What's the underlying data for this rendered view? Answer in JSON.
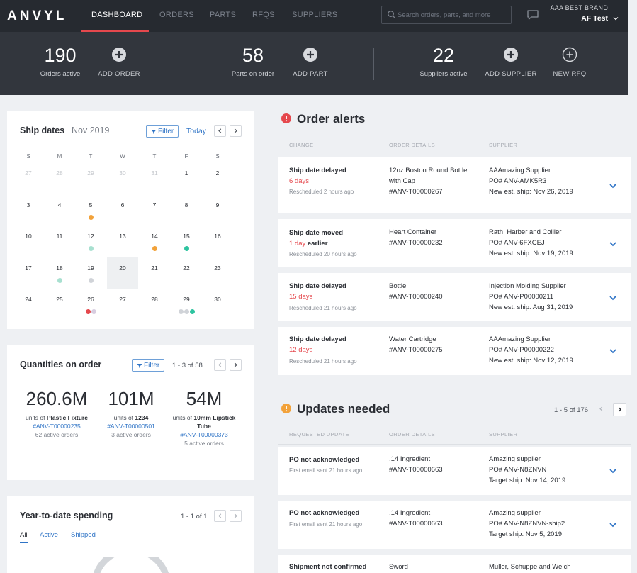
{
  "nav": {
    "logo": "ANVYL",
    "tabs": [
      "DASHBOARD",
      "ORDERS",
      "PARTS",
      "RFQS",
      "SUPPLIERS"
    ],
    "search_placeholder": "Search orders, parts, and more",
    "brand": "AAA BEST BRAND",
    "user": "AF Test"
  },
  "stats": {
    "orders_active": {
      "value": "190",
      "label": "Orders active",
      "action": "ADD ORDER"
    },
    "parts_on_order": {
      "value": "58",
      "label": "Parts on order",
      "action": "ADD PART"
    },
    "suppliers_active": {
      "value": "22",
      "label": "Suppliers active",
      "action": "ADD SUPPLIER"
    },
    "new_rfq": "NEW RFQ"
  },
  "ship_dates": {
    "title": "Ship dates",
    "month": "Nov 2019",
    "filter": "Filter",
    "today": "Today",
    "dow": [
      "S",
      "M",
      "T",
      "W",
      "T",
      "F",
      "S"
    ],
    "weeks": [
      [
        {
          "d": "27",
          "m": true
        },
        {
          "d": "28",
          "m": true
        },
        {
          "d": "29",
          "m": true
        },
        {
          "d": "30",
          "m": true
        },
        {
          "d": "31",
          "m": true
        },
        {
          "d": "1"
        },
        {
          "d": "2"
        }
      ],
      [
        {
          "d": "3"
        },
        {
          "d": "4"
        },
        {
          "d": "5",
          "dots": [
            "#f2a23a"
          ]
        },
        {
          "d": "6"
        },
        {
          "d": "7"
        },
        {
          "d": "8"
        },
        {
          "d": "9"
        }
      ],
      [
        {
          "d": "10"
        },
        {
          "d": "11"
        },
        {
          "d": "12",
          "dots": [
            "#a8e0d0"
          ]
        },
        {
          "d": "13"
        },
        {
          "d": "14",
          "dots": [
            "#f2a23a"
          ]
        },
        {
          "d": "15",
          "dots": [
            "#2ec4a0"
          ]
        },
        {
          "d": "16"
        }
      ],
      [
        {
          "d": "17"
        },
        {
          "d": "18",
          "dots": [
            "#a8e0d0"
          ]
        },
        {
          "d": "19",
          "dots": [
            "#d0d3d8"
          ]
        },
        {
          "d": "20",
          "today": true
        },
        {
          "d": "21"
        },
        {
          "d": "22"
        },
        {
          "d": "23"
        }
      ],
      [
        {
          "d": "24"
        },
        {
          "d": "25"
        },
        {
          "d": "26",
          "dots": [
            "#e5484d",
            "#d8cde0"
          ]
        },
        {
          "d": "27"
        },
        {
          "d": "28"
        },
        {
          "d": "29",
          "dots": [
            "#d0d3d8",
            "#d0d3d8",
            "#2ec4a0"
          ]
        },
        {
          "d": "30"
        }
      ]
    ],
    "colors": {
      "orange": "#f2a23a",
      "red": "#e5484d",
      "teal": "#2ec4a0",
      "mint": "#a8e0d0",
      "gray": "#d0d3d8"
    }
  },
  "quantities": {
    "title": "Quantities on order",
    "filter": "Filter",
    "pager": "1 - 3 of 58",
    "items": [
      {
        "value": "260.6M",
        "units": "units of",
        "part": "Plastic Fixture",
        "ref": "#ANV-T00000235",
        "active": "62 active orders"
      },
      {
        "value": "101M",
        "units": "units of",
        "part": "1234",
        "ref": "#ANV-T00000501",
        "active": "3 active orders"
      },
      {
        "value": "54M",
        "units": "units of",
        "part": "10mm Lipstick Tube",
        "ref": "#ANV-T00000373",
        "active": "5 active orders"
      }
    ]
  },
  "ytd": {
    "title": "Year-to-date spending",
    "pager": "1 - 1 of 1",
    "tabs": [
      "All",
      "Active",
      "Shipped"
    ]
  },
  "order_alerts": {
    "title": "Order alerts",
    "cols": [
      "CHANGE",
      "ORDER DETAILS",
      "SUPPLIER"
    ],
    "rows": [
      {
        "title": "Ship date delayed",
        "amount": "6 days",
        "amount_tail": "",
        "time": "Rescheduled 2 hours ago",
        "details": [
          "12oz Boston Round Bottle",
          "with Cap",
          "#ANV-T00000267"
        ],
        "supplier": [
          "AAAmazing Supplier",
          "PO# ANV-AMK5R3",
          "New est. ship: Nov 26, 2019"
        ]
      },
      {
        "title": "Ship date moved",
        "amount": "1 day",
        "amount_tail": " earlier",
        "time": "Rescheduled 20 hours ago",
        "details": [
          "Heart Container",
          "#ANV-T00000232"
        ],
        "supplier": [
          "Rath, Harber and Collier",
          "PO# ANV-6FXCEJ",
          "New est. ship: Nov 19, 2019"
        ]
      },
      {
        "title": "Ship date delayed",
        "amount": "15 days",
        "amount_tail": "",
        "time": "Rescheduled 21 hours ago",
        "details": [
          "Bottle",
          "#ANV-T00000240"
        ],
        "supplier": [
          "Injection Molding Supplier",
          "PO# ANV-P00000211",
          "New est. ship: Aug 31, 2019"
        ]
      },
      {
        "title": "Ship date delayed",
        "amount": "12 days",
        "amount_tail": "",
        "time": "Rescheduled 21 hours ago",
        "details": [
          "Water Cartridge",
          "#ANV-T00000275"
        ],
        "supplier": [
          "AAAmazing Supplier",
          "PO# ANV-P00000222",
          "New est. ship: Nov 12, 2019"
        ]
      }
    ]
  },
  "updates": {
    "title": "Updates needed",
    "pager": "1 - 5 of 176",
    "cols": [
      "REQUESTED UPDATE",
      "ORDER DETAILS",
      "SUPPLIER"
    ],
    "rows": [
      {
        "title": "PO not acknowledged",
        "time": "First email sent 21 hours ago",
        "details": [
          ".14 Ingredient",
          "#ANV-T00000663"
        ],
        "supplier": [
          "Amazing supplier",
          "PO# ANV-N8ZNVN",
          "Target ship: Nov 14, 2019"
        ]
      },
      {
        "title": "PO not acknowledged",
        "time": "First email sent 21 hours ago",
        "details": [
          ".14 Ingredient",
          "#ANV-T00000663"
        ],
        "supplier": [
          "Amazing supplier",
          "PO# ANV-N8ZNVN-ship2",
          "Target ship: Nov 5, 2019"
        ]
      },
      {
        "title": "Shipment not confirmed",
        "time": "",
        "details": [
          "Sword"
        ],
        "supplier": [
          "Muller, Schuppe and Welch"
        ]
      }
    ]
  },
  "theme": {
    "accent": "#2f74c6",
    "alert_red": "#e5484d",
    "warn_orange": "#f2a23a",
    "nav_bg": "#262a30",
    "stats_bg": "#32363d"
  }
}
